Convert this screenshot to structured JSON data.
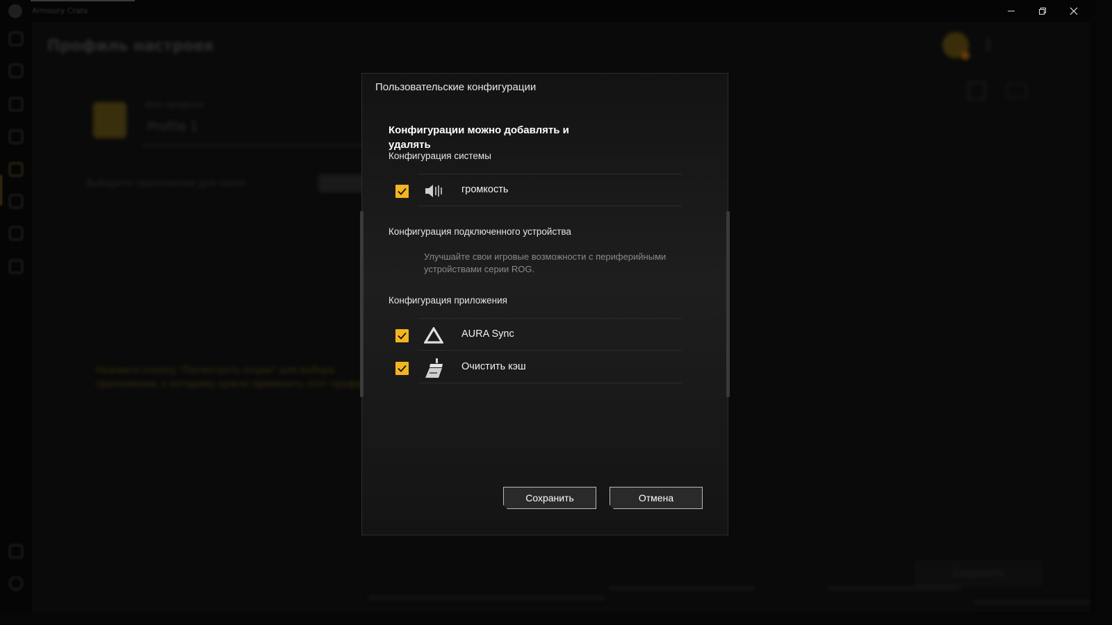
{
  "window": {
    "app_title": "Armoury Crate",
    "minimize_icon": "minimize-icon",
    "maximize_icon": "restore-icon",
    "close_icon": "close-icon"
  },
  "sidebar": {
    "items": [
      {
        "icon": "home-icon"
      },
      {
        "icon": "device-icon"
      },
      {
        "icon": "speaker-icon"
      },
      {
        "icon": "game-library-icon"
      },
      {
        "icon": "scenario-profile-icon",
        "active": true
      },
      {
        "icon": "featured-icon"
      },
      {
        "icon": "news-icon"
      },
      {
        "icon": "folder-icon"
      },
      {
        "icon": "user-icon"
      },
      {
        "icon": "settings-icon"
      }
    ]
  },
  "background": {
    "page_title": "Профиль настроек",
    "profile_label": "Имя профиля",
    "profile_name": "Profile 1",
    "select_app_label": "Выберите приложение для связи",
    "hint_text": "Нажмите кнопку \"Посмотреть опции\" для выбора приложения, к которому нужно применить этот профиль",
    "save_label": "Сохранить"
  },
  "dialog": {
    "title": "Пользовательские конфигурации",
    "heading": "Конфигурации можно добавлять и удалять",
    "system_section": {
      "title": "Конфигурация системы",
      "items": [
        {
          "label": "громкость",
          "checked": true,
          "icon": "volume-icon"
        }
      ]
    },
    "device_section": {
      "title": "Конфигурация подключенного устройства",
      "message": "Улучшайте свои игровые возможности с периферийными устройствами серии ROG."
    },
    "app_section": {
      "title": "Конфигурация приложения",
      "items": [
        {
          "label": "AURA Sync",
          "checked": true,
          "icon": "aura-sync-icon"
        },
        {
          "label": "Очистить кэш",
          "checked": true,
          "icon": "broom-icon"
        }
      ]
    },
    "buttons": {
      "save": "Сохранить",
      "cancel": "Отмена"
    },
    "colors": {
      "accent": "#f3b51f",
      "panel": "#1a1a1a"
    }
  }
}
